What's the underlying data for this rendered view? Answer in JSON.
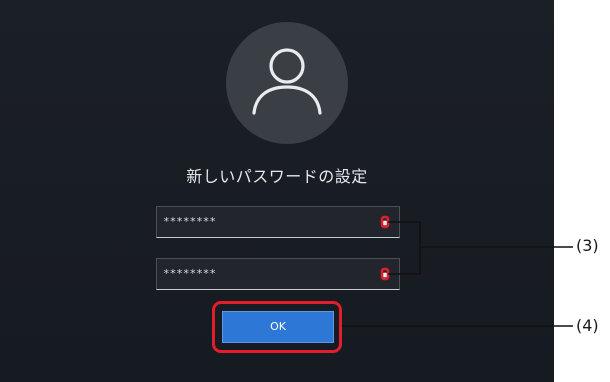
{
  "screen": {
    "title": "新しいパスワードの設定",
    "avatar_icon": "user-icon"
  },
  "fields": [
    {
      "value": "********",
      "reveal_icon": "eye-icon"
    },
    {
      "value": "********",
      "reveal_icon": "eye-icon"
    }
  ],
  "ok_button": {
    "label": "OK",
    "color": "#2d77d6"
  },
  "callouts": {
    "fields_label": "(3)",
    "ok_label": "(4)",
    "highlight_color": "#e31d2b"
  }
}
